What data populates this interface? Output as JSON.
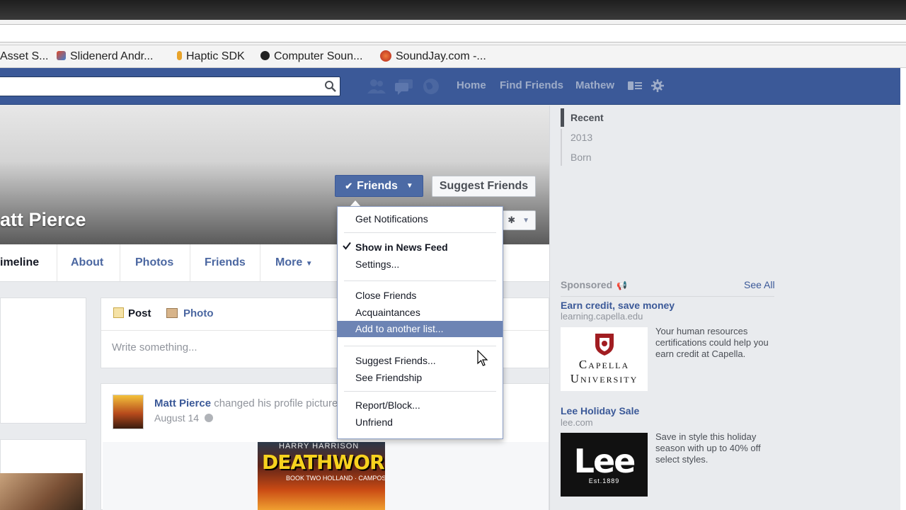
{
  "bookmarks": [
    {
      "label": "Asset S...",
      "icon": "asset-store-icon"
    },
    {
      "label": "Slidenerd Andr...",
      "icon": "slidenerd-icon"
    },
    {
      "label": "Haptic SDK",
      "icon": "haptic-icon"
    },
    {
      "label": "Computer Soun...",
      "icon": "computer-sound-icon"
    },
    {
      "label": "SoundJay.com -...",
      "icon": "soundjay-icon"
    }
  ],
  "header": {
    "nav": [
      "Home",
      "Find Friends",
      "Mathew"
    ]
  },
  "profile": {
    "name": "att Pierce",
    "friends_button": "Friends",
    "suggest_button": "Suggest Friends"
  },
  "tabs": [
    "imeline",
    "About",
    "Photos",
    "Friends",
    "More"
  ],
  "composer": {
    "post": "Post",
    "photo": "Photo",
    "placeholder": "Write something..."
  },
  "story": {
    "author": "Matt Pierce",
    "action": "changed his profile picture",
    "date": "August 14",
    "comic_title": "DEATHWORLD",
    "comic_sub": "BOOK TWO  HOLLAND · CAMPOS",
    "comic_top": "HARRY HARRISON"
  },
  "timeline_years": [
    "Recent",
    "2013",
    "Born"
  ],
  "sponsored": {
    "heading": "Sponsored",
    "see_all": "See All",
    "ads": [
      {
        "title": "Earn credit, save money",
        "url": "learning.capella.edu",
        "text": "Your human resources certifications could help you earn credit at Capella.",
        "logo_line1": "Capella",
        "logo_line2": "University"
      },
      {
        "title": "Lee Holiday Sale",
        "url": "lee.com",
        "text": "Save in style this holiday season with up to 40% off select styles.",
        "logo_line1": "Lee",
        "logo_line2": "Est.1889"
      }
    ]
  },
  "dropdown": {
    "get_notifications": "Get Notifications",
    "show_in_news_feed": "Show in News Feed",
    "settings": "Settings...",
    "close_friends": "Close Friends",
    "acquaintances": "Acquaintances",
    "add_to_list": "Add to another list...",
    "suggest_friends": "Suggest Friends...",
    "see_friendship": "See Friendship",
    "report_block": "Report/Block...",
    "unfriend": "Unfriend"
  },
  "colors": {
    "facebook_blue": "#3b5998",
    "highlight": "#6d84b4"
  }
}
